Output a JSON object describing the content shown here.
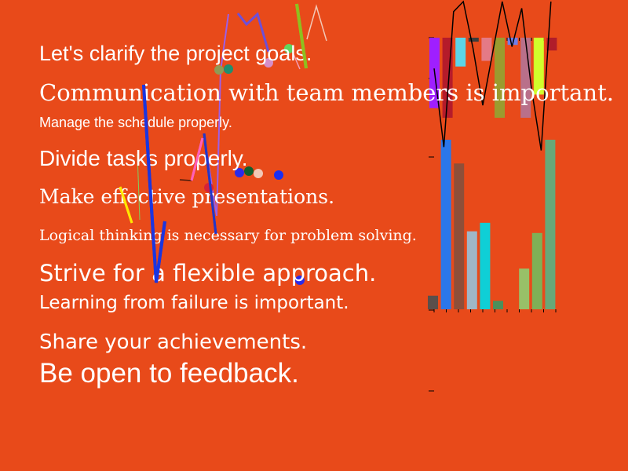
{
  "texts": {
    "l1": "Let's clarify the project goals.",
    "l2": "Communication with team members is important.",
    "l3": "Manage the schedule properly.",
    "l4": "Divide tasks properly.",
    "l5": "Make effective presentations.",
    "l6": "Logical thinking is necessary for problem solving.",
    "l7": "Strive for a flexible approach.",
    "l8": "Learning from failure is important.",
    "l9": "Share your achievements.",
    "l10": "Be open to feedback."
  },
  "colors": {
    "background": "#e84a1a",
    "text": "#ffffff"
  },
  "chart_data": {
    "type": "bar",
    "top_bars": [
      {
        "value": 0.88,
        "color": "#9f1fff"
      },
      {
        "value": 1.0,
        "color": "#b51b2a"
      },
      {
        "value": 0.36,
        "color": "#5cd5e8"
      },
      {
        "value": 0.05,
        "color": "#3c3c3c"
      },
      {
        "value": 0.29,
        "color": "#e47a86"
      },
      {
        "value": 1.0,
        "color": "#9b9b2f"
      },
      {
        "value": 0.09,
        "color": "#6f7fe8"
      },
      {
        "value": 1.0,
        "color": "#b9708a"
      },
      {
        "value": 0.71,
        "color": "#d1ff2b"
      },
      {
        "value": 0.16,
        "color": "#b01d2a"
      }
    ],
    "bottom_bars": [
      {
        "value": 0.08,
        "color": "#5a4f4b"
      },
      {
        "value": 1.0,
        "color": "#2a77ea"
      },
      {
        "value": 0.86,
        "color": "#8e4f39"
      },
      {
        "value": 0.46,
        "color": "#9fb7c7"
      },
      {
        "value": 0.51,
        "color": "#0fcfd6"
      },
      {
        "value": 0.05,
        "color": "#4c8f5b"
      },
      {
        "value": 0.0,
        "color": "#e84a1a"
      },
      {
        "value": 0.24,
        "color": "#98c068"
      },
      {
        "value": 0.45,
        "color": "#7fb056"
      },
      {
        "value": 1.0,
        "color": "#68a878"
      }
    ],
    "line_values": [
      0.6,
      0.13,
      0.94,
      1.0,
      0.72,
      0.38,
      0.69,
      1.0,
      0.73,
      0.96,
      0.48,
      0.11,
      1.0
    ],
    "line_color": "#000000"
  }
}
